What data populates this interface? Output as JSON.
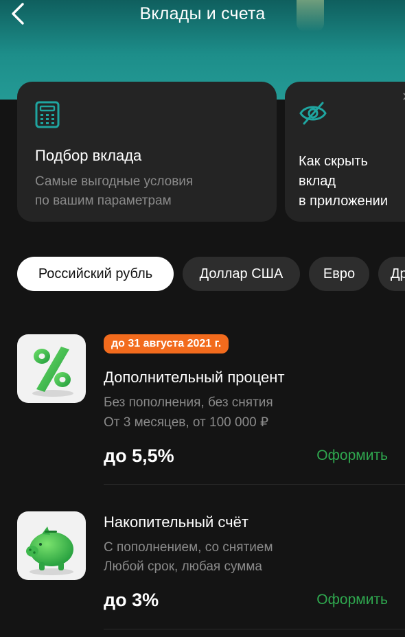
{
  "header": {
    "title": "Вклады и счета",
    "back_icon": "chevron-left-icon",
    "color": "#1d8e8a"
  },
  "promos": [
    {
      "icon": "calculator-icon",
      "title": "Подбор вклада",
      "subtitle_line1": "Самые выгодные условия",
      "subtitle_line2": "по вашим параметрам"
    },
    {
      "icon": "eye-off-icon",
      "title_line1": "Как скрыть",
      "title_line2": "вклад",
      "title_line3": "в приложении"
    }
  ],
  "currencies": [
    {
      "label": "Российский рубль",
      "active": true
    },
    {
      "label": "Доллар США",
      "active": false
    },
    {
      "label": "Евро",
      "active": false
    },
    {
      "label": "Др",
      "active": false
    }
  ],
  "products": [
    {
      "badge": "до 31 августа 2021 г.",
      "title": "Дополнительный процент",
      "line1": "Без пополнения, без снятия",
      "line2": "От 3 месяцев, от 100 000 ₽",
      "rate": "до 5,5%",
      "action": "Оформить",
      "icon": "percent-icon"
    },
    {
      "title": "Накопительный счёт",
      "line1": "С пополнением, со снятием",
      "line2": "Любой срок, любая сумма",
      "rate": "до 3%",
      "action": "Оформить",
      "icon": "piggy-bank-icon"
    }
  ],
  "colors": {
    "accent_green": "#2fa84f",
    "badge_orange": "#f26b1d",
    "icon_teal": "#1fa5a0"
  }
}
